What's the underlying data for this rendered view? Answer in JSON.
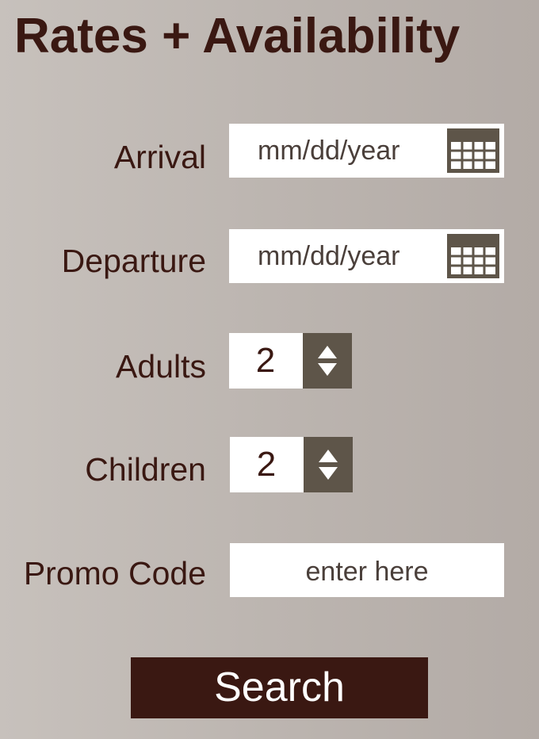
{
  "page": {
    "title": "Rates + Availability"
  },
  "form": {
    "arrival": {
      "label": "Arrival",
      "placeholder": "mm/dd/year",
      "icon": "calendar-icon"
    },
    "departure": {
      "label": "Departure",
      "placeholder": "mm/dd/year",
      "icon": "calendar-icon"
    },
    "adults": {
      "label": "Adults",
      "value": "2",
      "icon": "up-down-arrows-icon"
    },
    "children": {
      "label": "Children",
      "value": "2",
      "icon": "up-down-arrows-icon"
    },
    "promo": {
      "label": "Promo Code",
      "placeholder": "enter here"
    },
    "search_label": "Search"
  },
  "colors": {
    "brand_dark": "#3a1812",
    "control_bg": "#5e5549",
    "field_bg": "#ffffff",
    "page_bg": "#bcb5b0"
  }
}
